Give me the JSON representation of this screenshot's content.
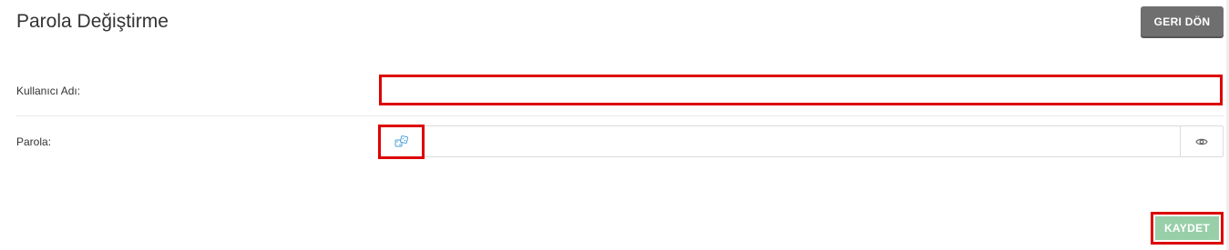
{
  "page": {
    "title": "Parola Değiştirme",
    "back_button_label": "GERI DÖN"
  },
  "form": {
    "username": {
      "label": "Kullanıcı Adı:",
      "value": ""
    },
    "password": {
      "label": "Parola:",
      "value": "",
      "generate_icon": "dice-icon",
      "toggle_icon": "eye-icon"
    }
  },
  "actions": {
    "save_label": "KAYDET"
  },
  "colors": {
    "back_button": "#6f6f6f",
    "save_button": "#98cfa9",
    "highlight_border": "#dd0000",
    "generate_icon": "#4a9fd8"
  }
}
